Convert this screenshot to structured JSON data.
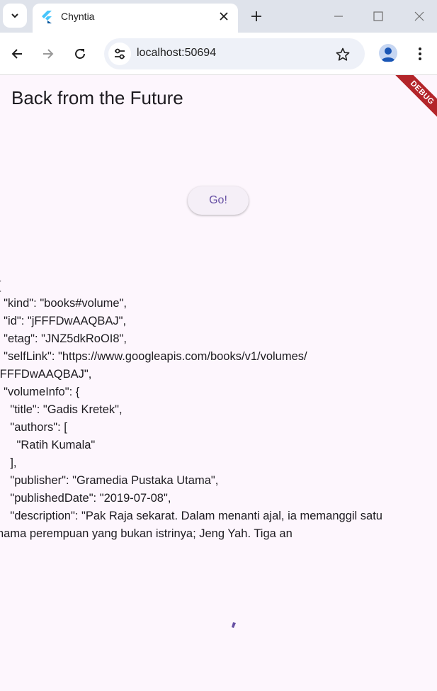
{
  "browser": {
    "tab_title": "Chyntia",
    "url": "localhost:50694"
  },
  "app": {
    "title": "Back from the Future",
    "go_button": "Go!",
    "debug_banner": "DEBUG",
    "json_lines": [
      "{",
      "  \"kind\": \"books#volume\",",
      "  \"id\": \"jFFFDwAAQBAJ\",",
      "  \"etag\": \"JNZ5dkRoOI8\",",
      "  \"selfLink\": \"https://www.googleapis.com/books/v1/volumes/",
      "jFFFDwAAQBAJ\",",
      "  \"volumeInfo\": {",
      "    \"title\": \"Gadis Kretek\",",
      "    \"authors\": [",
      "      \"Ratih Kumala\"",
      "    ],",
      "    \"publisher\": \"Gramedia Pustaka Utama\",",
      "    \"publishedDate\": \"2019-07-08\",",
      "    \"description\": \"Pak Raja sekarat. Dalam menanti ajal, ia memanggil satu",
      "nama perempuan yang bukan istrinya; Jeng Yah. Tiga an"
    ]
  },
  "colors": {
    "tabstrip": "#dfe3eb",
    "app_background": "#fdf6fd",
    "accent": "#6750a4",
    "debug_ribbon": "#b3252a"
  },
  "icons": {
    "tab_search": "chevron-down-icon",
    "favicon": "flutter-icon",
    "close": "close-icon",
    "new_tab": "plus-icon",
    "back": "arrow-left-icon",
    "forward": "arrow-right-icon",
    "reload": "reload-icon",
    "site_info": "tune-icon",
    "bookmark": "star-icon",
    "profile": "person-icon",
    "menu": "kebab-menu-icon",
    "loading": "spinner-icon"
  }
}
